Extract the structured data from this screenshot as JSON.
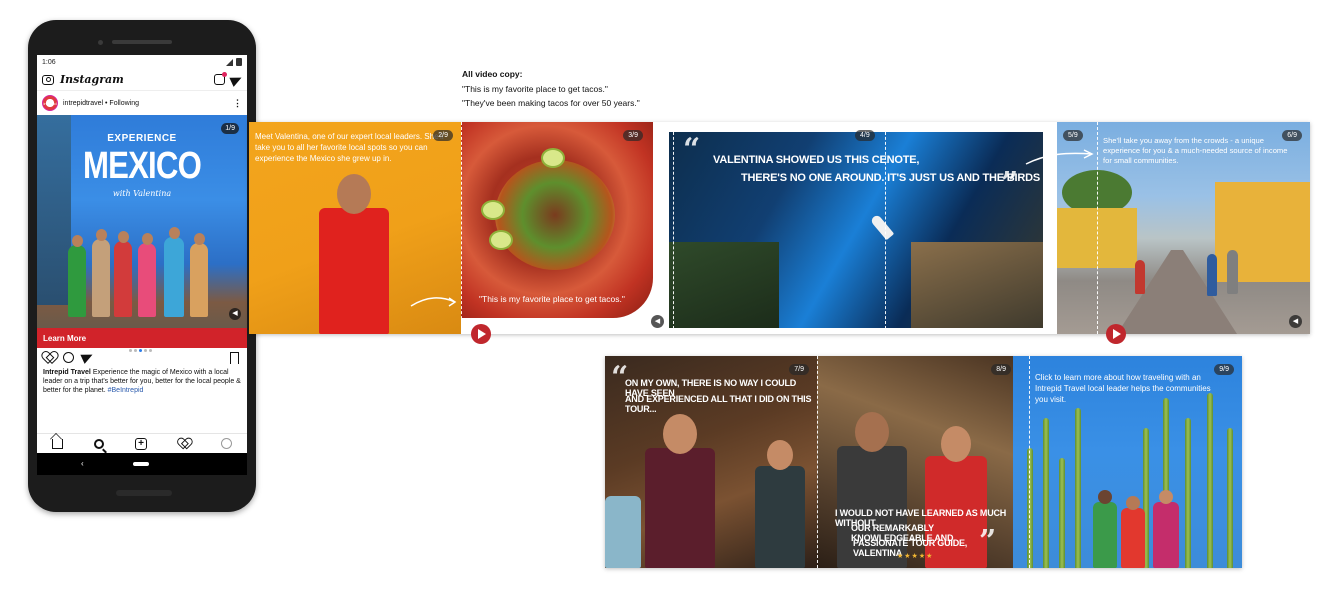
{
  "status": {
    "time": "1:06"
  },
  "instagram": {
    "logo": "Instagram",
    "account": "intrepidtravel",
    "following": "• Following",
    "avatar_text": "intrepid",
    "more": "⋮",
    "slide_counter": "1/9",
    "hero": {
      "line1": "EXPERIENCE",
      "line2": "MEXICO",
      "line3": "with Valentina"
    },
    "cta": "Learn More",
    "caption_brand": "Intrepid Travel",
    "caption_text": "Experience the magic of Mexico with a local leader on a trip that's better for you, better for the local people & better for the planet.",
    "caption_tag": "#BeIntrepid",
    "sys_back": "‹"
  },
  "video_copy": {
    "heading": "All video copy:",
    "line1": "\"This is my favorite place to get tacos.\"",
    "line2": "\"They've been making tacos for over 50 years.\""
  },
  "panels": {
    "p2": {
      "counter": "2/9",
      "text": "Meet Valentina, one of our expert local leaders. She'll take you to all her favorite local spots so you can experience the Mexico she grew up in."
    },
    "p3": {
      "counter": "3/9",
      "caption": "\"This is my favorite place to get tacos.\""
    },
    "p4": {
      "counter": "4/9",
      "caption_line1": "VALENTINA SHOWED US THIS CENOTE,",
      "caption_line2": "THERE'S NO ONE AROUND. IT'S JUST US AND THE BIRDS"
    },
    "p5": {
      "counter": "5/9"
    },
    "p6": {
      "counter": "6/9",
      "text": "She'll take you away from the crowds - a unique experience for you & a much-needed source of income for small communities."
    },
    "p7": {
      "counter": "7/9",
      "quote_line1": "ON MY OWN, THERE IS NO WAY I COULD HAVE SEEN",
      "quote_line2": "AND EXPERIENCED ALL THAT I DID ON THIS TOUR..."
    },
    "p8": {
      "counter": "8/9",
      "quote_line1": "I WOULD NOT HAVE LEARNED AS MUCH WITHOUT",
      "quote_line2": "OUR REMARKABLY KNOWLEDGEABLE AND",
      "quote_line3": "PASSIONATE TOUR GUIDE, VALENTINA",
      "stars": "★★★★★"
    },
    "p9": {
      "counter": "9/9",
      "text": "Click to learn more about how traveling with an Intrepid Travel local leader helps the communities you visit."
    }
  },
  "icons": {
    "mute": "◀",
    "quote_open": "“",
    "quote_close": "”"
  },
  "colors": {
    "brand_red": "#d1232a",
    "play_red": "#c0272d",
    "hashtag_blue": "#2b5bad"
  }
}
